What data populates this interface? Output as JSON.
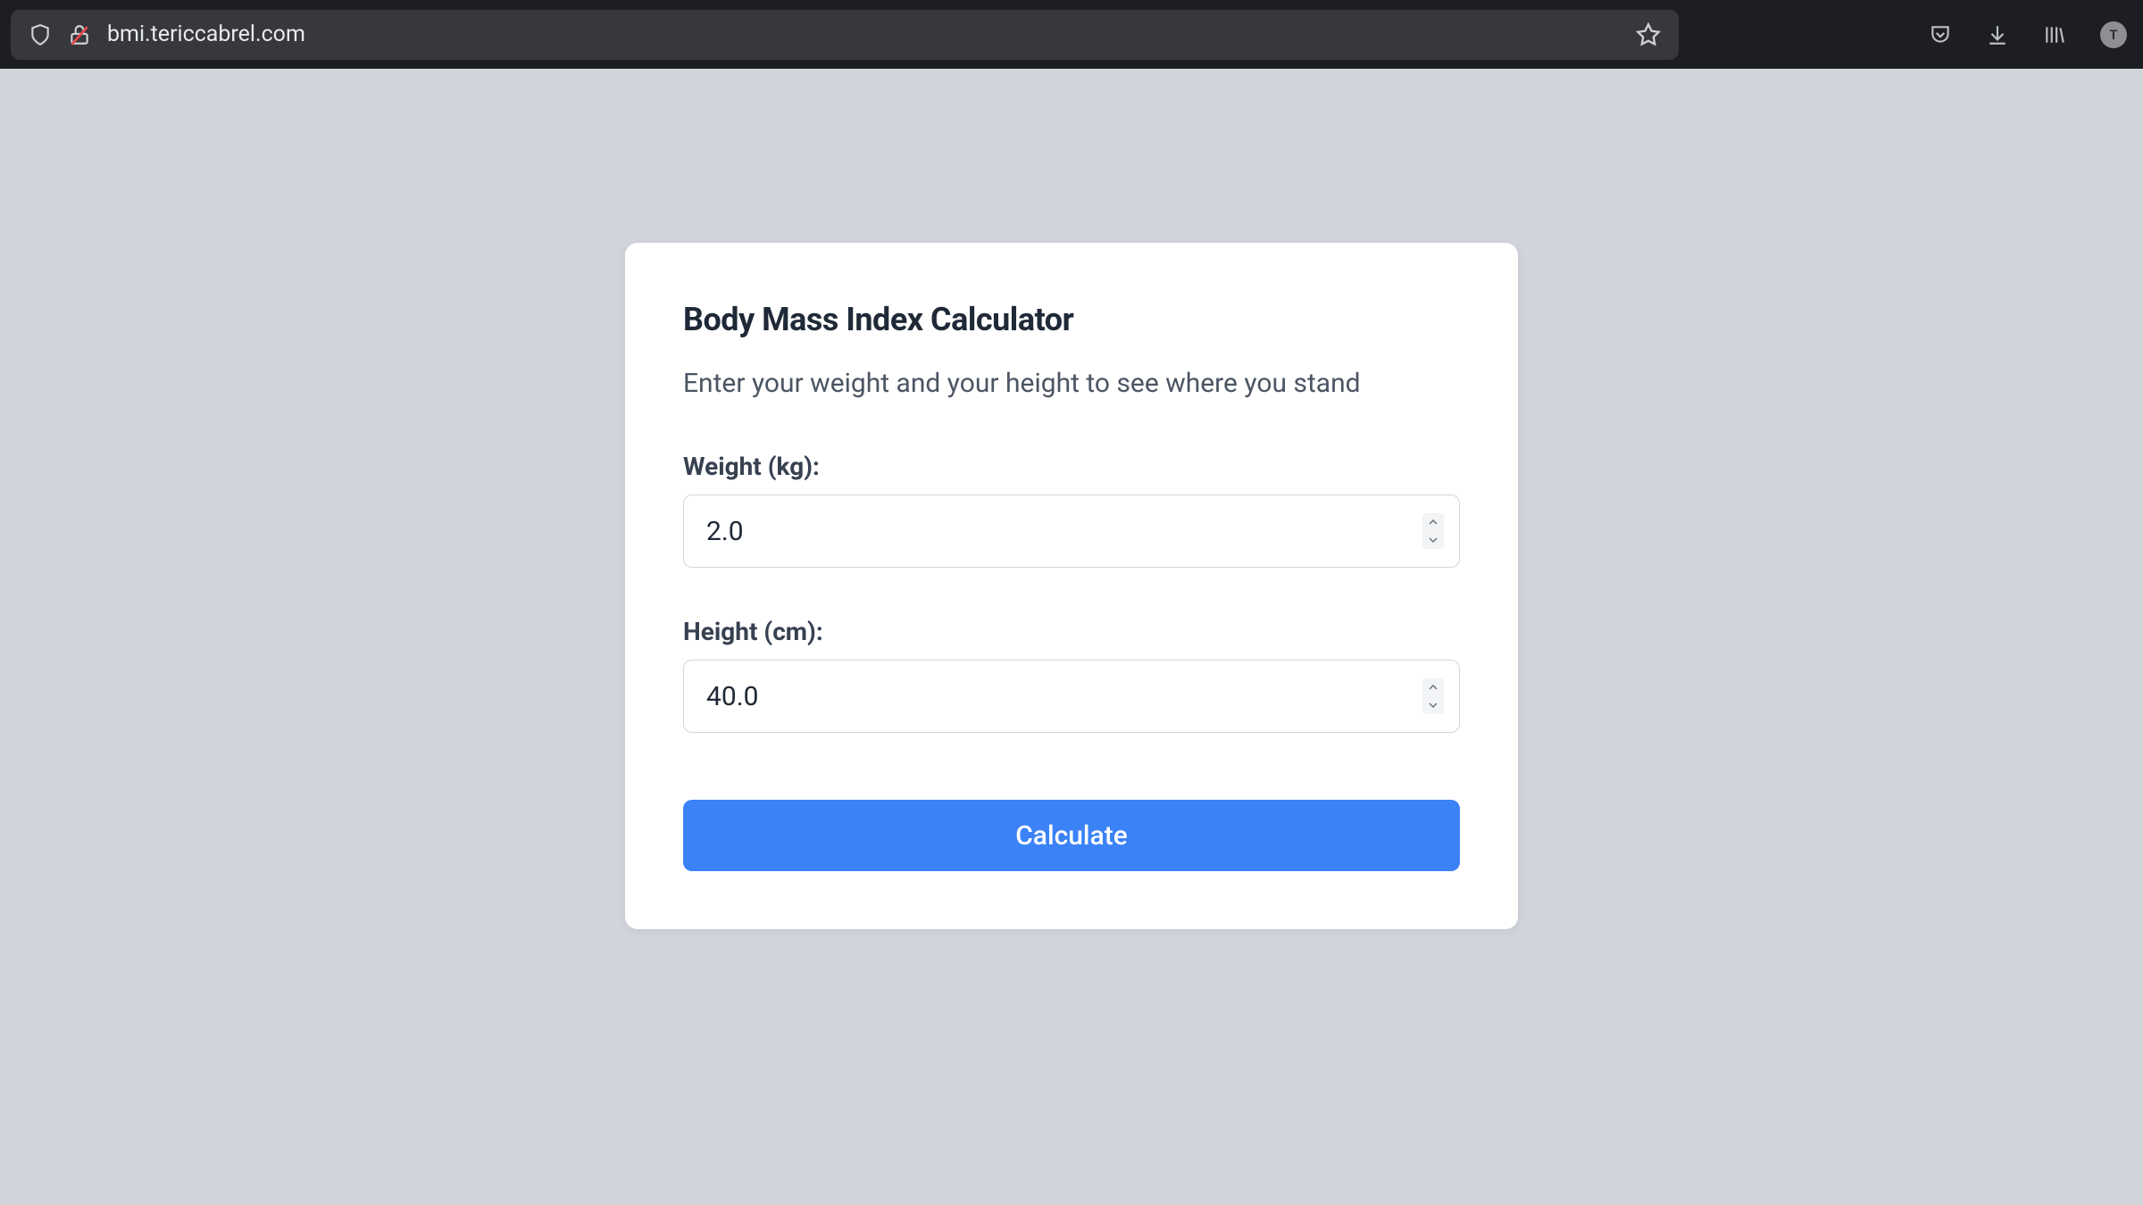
{
  "browser": {
    "url": "bmi.tericcabrel.com",
    "avatar_letter": "T"
  },
  "card": {
    "title": "Body Mass Index Calculator",
    "subtitle": "Enter your weight and your height to see where you stand"
  },
  "form": {
    "weight": {
      "label": "Weight (kg):",
      "value": "2.0"
    },
    "height": {
      "label": "Height (cm):",
      "value": "40.0"
    },
    "submit_label": "Calculate"
  }
}
